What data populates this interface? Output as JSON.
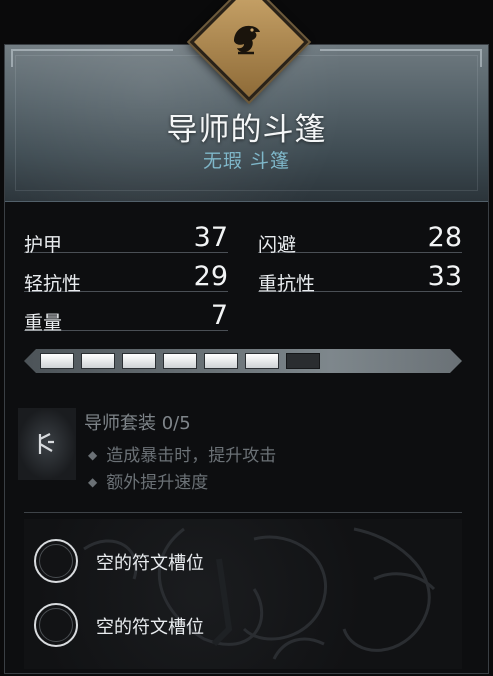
{
  "item": {
    "name": "导师的斗篷",
    "subtitle": "无瑕 斗篷"
  },
  "stats": [
    {
      "label": "护甲",
      "value": "37"
    },
    {
      "label": "闪避",
      "value": "28"
    },
    {
      "label": "轻抗性",
      "value": "29"
    },
    {
      "label": "重抗性",
      "value": "33"
    },
    {
      "label": "重量",
      "value": "7"
    }
  ],
  "upgrade": {
    "filled": 6,
    "total": 7
  },
  "set": {
    "title": "导师套装 0/5",
    "bonuses": [
      "造成暴击时，提升攻击",
      "额外提升速度"
    ]
  },
  "rune_slots": [
    {
      "label": "空的符文槽位"
    },
    {
      "label": "空的符文槽位"
    }
  ],
  "icons": {
    "emblem": "raven-emblem-icon",
    "set": "rune-set-icon"
  },
  "colors": {
    "accent_subtitle": "#7fb7c9",
    "emblem_gold": "#caa56a"
  }
}
